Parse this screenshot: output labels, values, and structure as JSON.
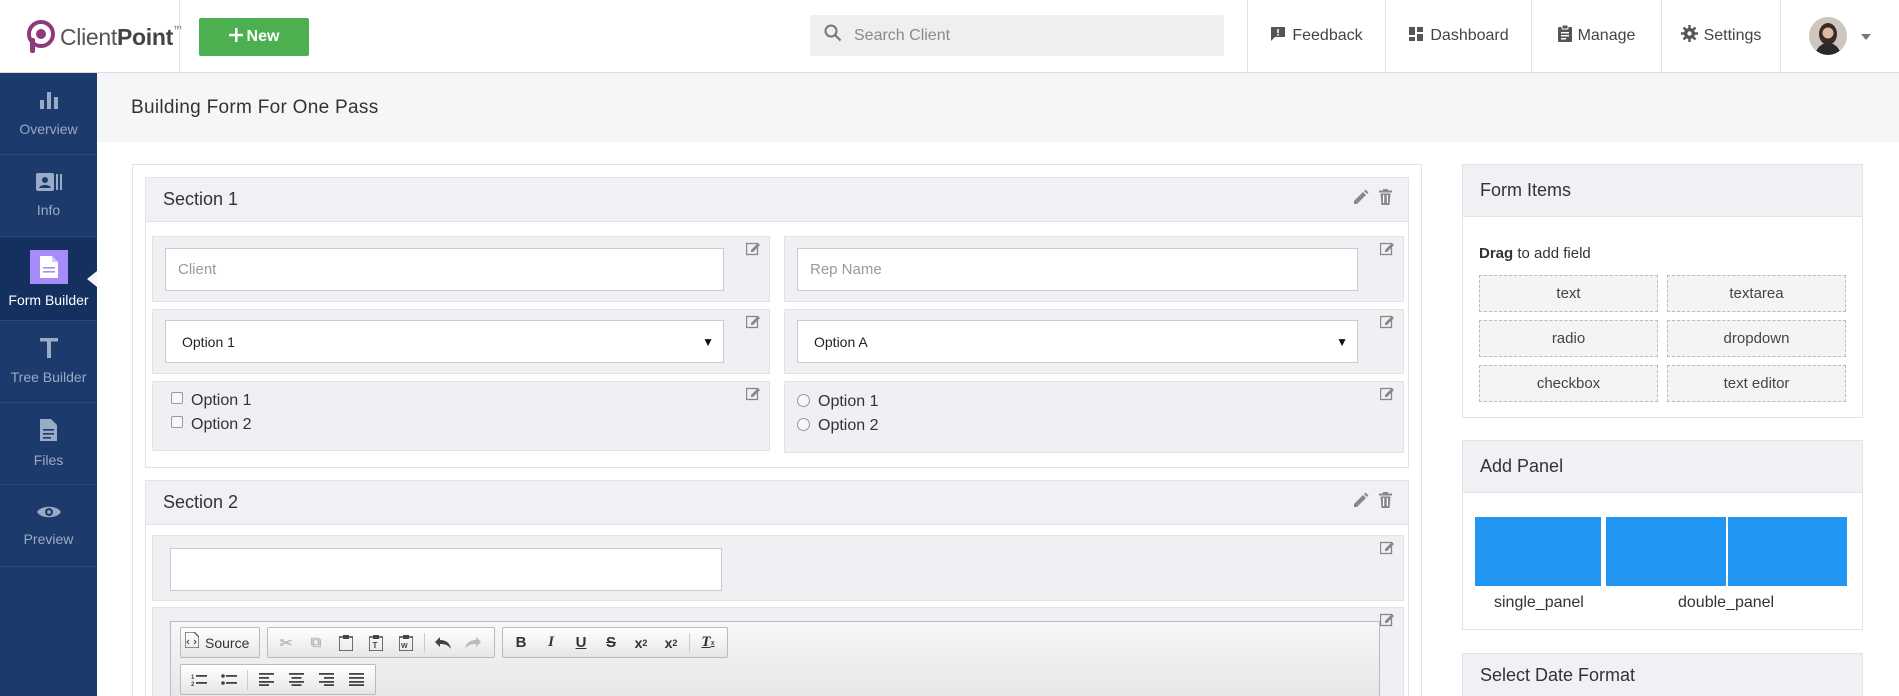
{
  "brand": {
    "name_light": "Client",
    "name_bold": "Point",
    "tm": "™"
  },
  "toolbar": {
    "new_label": "New"
  },
  "search": {
    "placeholder": "Search Client"
  },
  "nav": [
    {
      "label": "Feedback",
      "icon": "feedback-icon"
    },
    {
      "label": "Dashboard",
      "icon": "dashboard-icon"
    },
    {
      "label": "Manage",
      "icon": "clipboard-icon"
    },
    {
      "label": "Settings",
      "icon": "gear-icon"
    }
  ],
  "sidebar": {
    "items": [
      {
        "label": "Overview",
        "icon": "bar-chart-icon"
      },
      {
        "label": "Info",
        "icon": "contact-card-icon"
      },
      {
        "label": "Form Builder",
        "icon": "document-icon",
        "active": true
      },
      {
        "label": "Tree Builder",
        "icon": "text-t-icon"
      },
      {
        "label": "Files",
        "icon": "file-icon"
      },
      {
        "label": "Preview",
        "icon": "eye-icon"
      }
    ]
  },
  "page": {
    "title": "Building Form For One Pass"
  },
  "sections": [
    {
      "title": "Section 1",
      "fields": {
        "client_placeholder": "Client",
        "rep_placeholder": "Rep Name",
        "select_left": "Option 1",
        "select_right": "Option A",
        "checkboxes": [
          "Option 1",
          "Option 2"
        ],
        "radios": [
          "Option 1",
          "Option 2"
        ]
      }
    },
    {
      "title": "Section 2",
      "editor": {
        "source_label": "Source"
      }
    }
  ],
  "form_items": {
    "title": "Form Items",
    "hint_bold": "Drag",
    "hint_rest": " to add field",
    "items": [
      "text",
      "textarea",
      "radio",
      "dropdown",
      "checkbox",
      "text editor"
    ]
  },
  "add_panel": {
    "title": "Add Panel",
    "single_label": "single_panel",
    "double_label": "double_panel"
  },
  "date_format": {
    "title": "Select Date Format"
  },
  "colors": {
    "accent_green": "#4caf50",
    "sidebar": "#1c3a6b",
    "active_icon": "#a78bfa",
    "panel_blue": "#2196f3"
  }
}
